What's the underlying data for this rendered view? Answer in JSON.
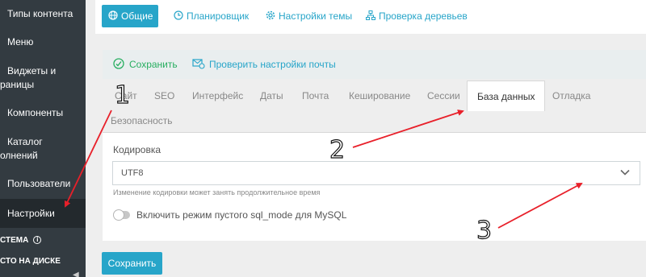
{
  "sidebar": {
    "items": [
      {
        "label": "Типы контента",
        "cut": false
      },
      {
        "label": "Меню",
        "cut": false
      },
      {
        "label_line1": "Виджеты и",
        "label_line2": "раницы"
      },
      {
        "label": "Компоненты",
        "cut": false
      },
      {
        "label_line1": "Каталог",
        "label_line2": "олнений"
      },
      {
        "label": "Пользователи",
        "cut": false
      },
      {
        "label": "Настройки",
        "cut": false
      }
    ],
    "section_system": "СТЕМА",
    "section_disk": "СТО НА ДИСКЕ"
  },
  "top_tabs": [
    {
      "label": "Общие",
      "icon": "globe-icon"
    },
    {
      "label": "Планировщик",
      "icon": "clock-icon"
    },
    {
      "label": "Настройки темы",
      "icon": "gear-icon"
    },
    {
      "label": "Проверка деревьев",
      "icon": "tree-icon"
    }
  ],
  "actions": {
    "save": "Сохранить",
    "check_mail": "Проверить настройки почты"
  },
  "settings_tabs": [
    "Сайт",
    "SEO",
    "Интерфейс",
    "Даты",
    "Почта",
    "Кеширование",
    "Сессии",
    "База данных",
    "Отладка",
    "Безопасность"
  ],
  "active_settings_tab": "База данных",
  "form": {
    "encoding_label": "Кодировка",
    "encoding_value": "UTF8",
    "encoding_help": "Изменение кодировки может занять продолжительное время",
    "sql_mode_label": "Включить режим пустого sql_mode для MySQL",
    "sql_mode_enabled": false
  },
  "save_button": "Сохранить",
  "annotations": [
    "1",
    "2",
    "3"
  ],
  "colors": {
    "accent": "#27a5c9",
    "sidebar_bg": "#333b41",
    "arrow": "#e8202a",
    "save_icon": "#27ae60"
  }
}
